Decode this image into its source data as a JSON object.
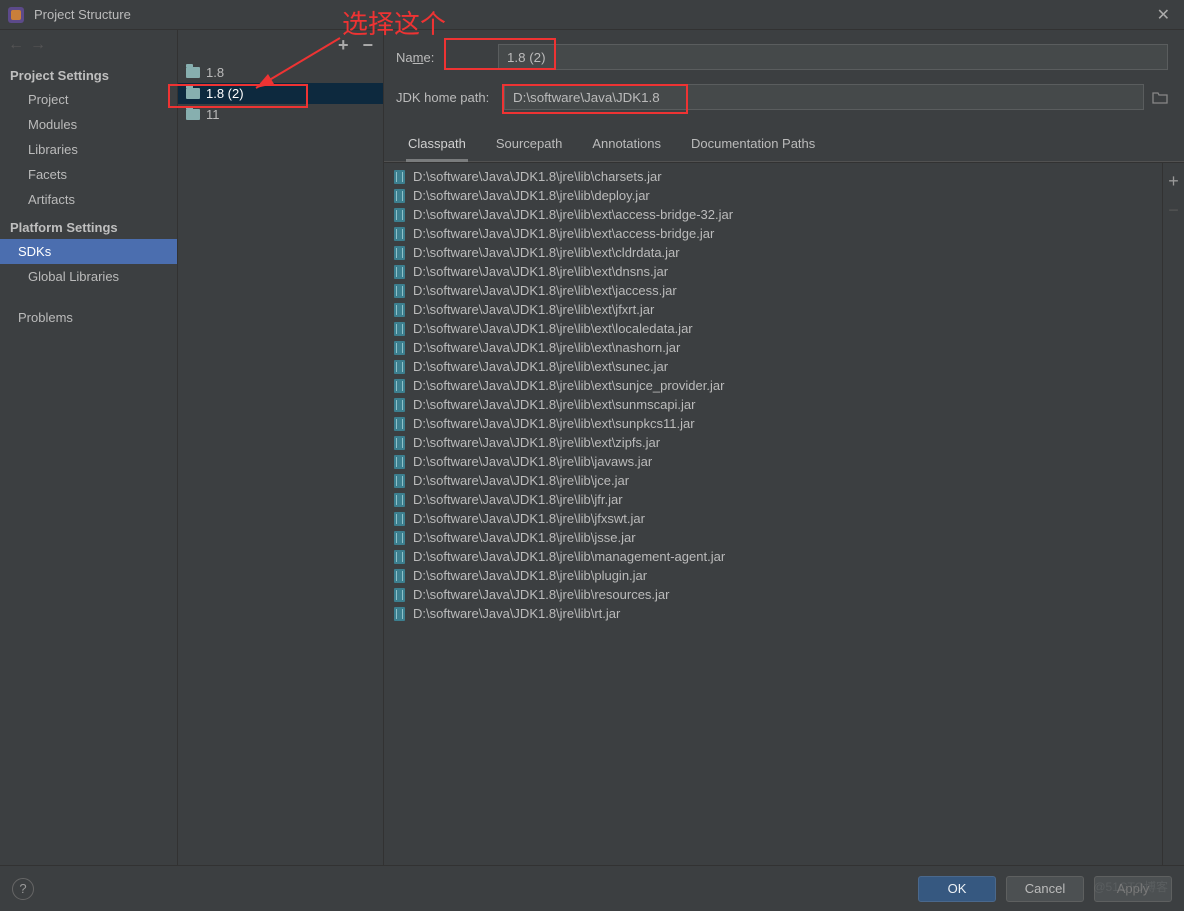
{
  "window": {
    "title": "Project Structure"
  },
  "nav": {
    "project_settings_hdr": "Project Settings",
    "platform_settings_hdr": "Platform Settings",
    "items": {
      "project": "Project",
      "modules": "Modules",
      "libraries": "Libraries",
      "facets": "Facets",
      "artifacts": "Artifacts",
      "sdks": "SDKs",
      "global_libraries": "Global Libraries",
      "problems": "Problems"
    }
  },
  "sdk_list": {
    "items": [
      {
        "label": "1.8"
      },
      {
        "label": "1.8 (2)"
      },
      {
        "label": "11"
      }
    ]
  },
  "form": {
    "name_label_prefix": "Na",
    "name_label_u": "m",
    "name_label_suffix": "e:",
    "name_value": "1.8 (2)",
    "jdk_label": "JDK home path:",
    "jdk_value": "D:\\software\\Java\\JDK1.8"
  },
  "tabs": {
    "classpath": "Classpath",
    "sourcepath": "Sourcepath",
    "annotations": "Annotations",
    "docs": "Documentation Paths"
  },
  "jars": [
    "D:\\software\\Java\\JDK1.8\\jre\\lib\\charsets.jar",
    "D:\\software\\Java\\JDK1.8\\jre\\lib\\deploy.jar",
    "D:\\software\\Java\\JDK1.8\\jre\\lib\\ext\\access-bridge-32.jar",
    "D:\\software\\Java\\JDK1.8\\jre\\lib\\ext\\access-bridge.jar",
    "D:\\software\\Java\\JDK1.8\\jre\\lib\\ext\\cldrdata.jar",
    "D:\\software\\Java\\JDK1.8\\jre\\lib\\ext\\dnsns.jar",
    "D:\\software\\Java\\JDK1.8\\jre\\lib\\ext\\jaccess.jar",
    "D:\\software\\Java\\JDK1.8\\jre\\lib\\ext\\jfxrt.jar",
    "D:\\software\\Java\\JDK1.8\\jre\\lib\\ext\\localedata.jar",
    "D:\\software\\Java\\JDK1.8\\jre\\lib\\ext\\nashorn.jar",
    "D:\\software\\Java\\JDK1.8\\jre\\lib\\ext\\sunec.jar",
    "D:\\software\\Java\\JDK1.8\\jre\\lib\\ext\\sunjce_provider.jar",
    "D:\\software\\Java\\JDK1.8\\jre\\lib\\ext\\sunmscapi.jar",
    "D:\\software\\Java\\JDK1.8\\jre\\lib\\ext\\sunpkcs11.jar",
    "D:\\software\\Java\\JDK1.8\\jre\\lib\\ext\\zipfs.jar",
    "D:\\software\\Java\\JDK1.8\\jre\\lib\\javaws.jar",
    "D:\\software\\Java\\JDK1.8\\jre\\lib\\jce.jar",
    "D:\\software\\Java\\JDK1.8\\jre\\lib\\jfr.jar",
    "D:\\software\\Java\\JDK1.8\\jre\\lib\\jfxswt.jar",
    "D:\\software\\Java\\JDK1.8\\jre\\lib\\jsse.jar",
    "D:\\software\\Java\\JDK1.8\\jre\\lib\\management-agent.jar",
    "D:\\software\\Java\\JDK1.8\\jre\\lib\\plugin.jar",
    "D:\\software\\Java\\JDK1.8\\jre\\lib\\resources.jar",
    "D:\\software\\Java\\JDK1.8\\jre\\lib\\rt.jar"
  ],
  "buttons": {
    "ok": "OK",
    "cancel": "Cancel",
    "apply": "Apply"
  },
  "annotation": {
    "text": "选择这个"
  },
  "colors": {
    "accent": "#4b6eaf",
    "highlight_red": "#e33"
  }
}
